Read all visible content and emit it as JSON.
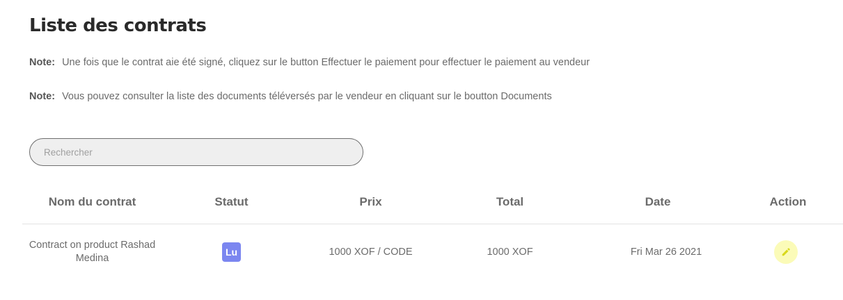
{
  "page": {
    "title": "Liste des contrats"
  },
  "notes": [
    {
      "label": "Note:",
      "text": "Une fois que le contrat aie été signé, cliquez sur le button Effectuer le paiement pour effectuer le paiement au vendeur"
    },
    {
      "label": "Note:",
      "text": "Vous pouvez consulter la liste des documents téléversés par le vendeur en cliquant sur le boutton Documents"
    }
  ],
  "search": {
    "placeholder": "Rechercher",
    "value": ""
  },
  "table": {
    "columns": [
      "Nom du contrat",
      "Statut",
      "Prix",
      "Total",
      "Date",
      "Action"
    ],
    "rows": [
      {
        "name": "Contract on product Rashad Medina",
        "status": "Lu",
        "status_color": "#7b86f0",
        "price": "1000 XOF / CODE",
        "total": "1000 XOF",
        "date": "Fri Mar 26 2021",
        "action_icon": "pencil-icon",
        "action_color": "#fbfbb8"
      }
    ]
  }
}
